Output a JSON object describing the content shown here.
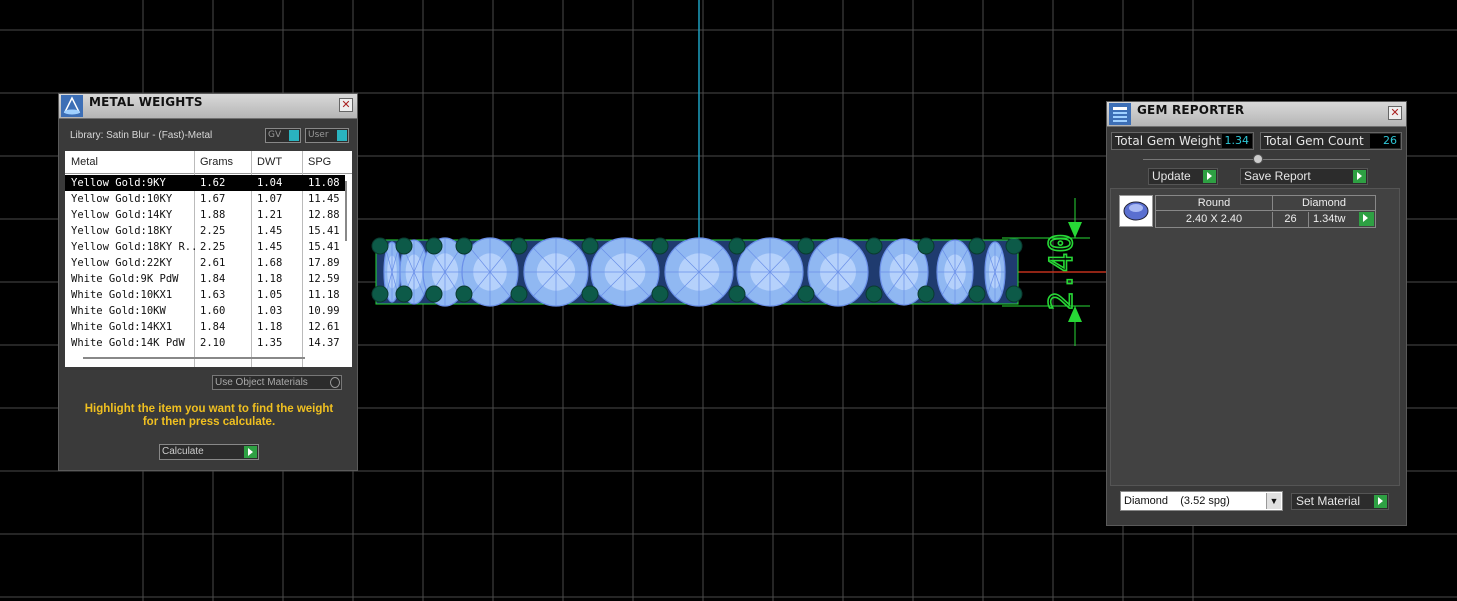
{
  "viewport": {
    "dimension_label": "2.40",
    "colors": {
      "grid": "#4a4a4a",
      "dimension": "#27d836",
      "gem": "#90b8f2",
      "prong": "#0d5a48",
      "axis_v": "#1e9fbf",
      "axis_h": "#c0301c"
    }
  },
  "metal_weights": {
    "title": "METAL WEIGHTS",
    "library": "Library: Satin Blur - (Fast)-Metal",
    "toggle_gv": "GV",
    "toggle_user": "User",
    "columns": [
      "Metal",
      "Grams",
      "DWT",
      "SPG"
    ],
    "rows": [
      {
        "metal": "Yellow Gold:9KY",
        "grams": "1.62",
        "dwt": "1.04",
        "spg": "11.08"
      },
      {
        "metal": "Yellow Gold:10KY",
        "grams": "1.67",
        "dwt": "1.07",
        "spg": "11.45"
      },
      {
        "metal": "Yellow Gold:14KY",
        "grams": "1.88",
        "dwt": "1.21",
        "spg": "12.88"
      },
      {
        "metal": "Yellow Gold:18KY",
        "grams": "2.25",
        "dwt": "1.45",
        "spg": "15.41"
      },
      {
        "metal": "Yellow Gold:18KY R...",
        "grams": "2.25",
        "dwt": "1.45",
        "spg": "15.41"
      },
      {
        "metal": "Yellow Gold:22KY",
        "grams": "2.61",
        "dwt": "1.68",
        "spg": "17.89"
      },
      {
        "metal": "White Gold:9K PdW",
        "grams": "1.84",
        "dwt": "1.18",
        "spg": "12.59"
      },
      {
        "metal": "White Gold:10KX1",
        "grams": "1.63",
        "dwt": "1.05",
        "spg": "11.18"
      },
      {
        "metal": "White Gold:10KW",
        "grams": "1.60",
        "dwt": "1.03",
        "spg": "10.99"
      },
      {
        "metal": "White Gold:14KX1",
        "grams": "1.84",
        "dwt": "1.18",
        "spg": "12.61"
      },
      {
        "metal": "White Gold:14K PdW",
        "grams": "2.10",
        "dwt": "1.35",
        "spg": "14.37"
      }
    ],
    "use_object_materials": "Use Object Materials",
    "instructions_line1": "Highlight the item you want to find the weight",
    "instructions_line2": "for then press calculate.",
    "calculate_label": "Calculate"
  },
  "gem_reporter": {
    "title": "GEM REPORTER",
    "total_weight_label": "Total Gem Weight",
    "total_weight_value": "1.34",
    "total_count_label": "Total Gem Count",
    "total_count_value": "26",
    "update_label": "Update",
    "save_report_label": "Save Report",
    "report": {
      "shape": "Round",
      "material": "Diamond",
      "size": "2.40 X 2.40",
      "count": "26",
      "carats": "1.34tw"
    },
    "material_select": "Diamond    (3.52 spg)",
    "set_material_label": "Set Material"
  }
}
